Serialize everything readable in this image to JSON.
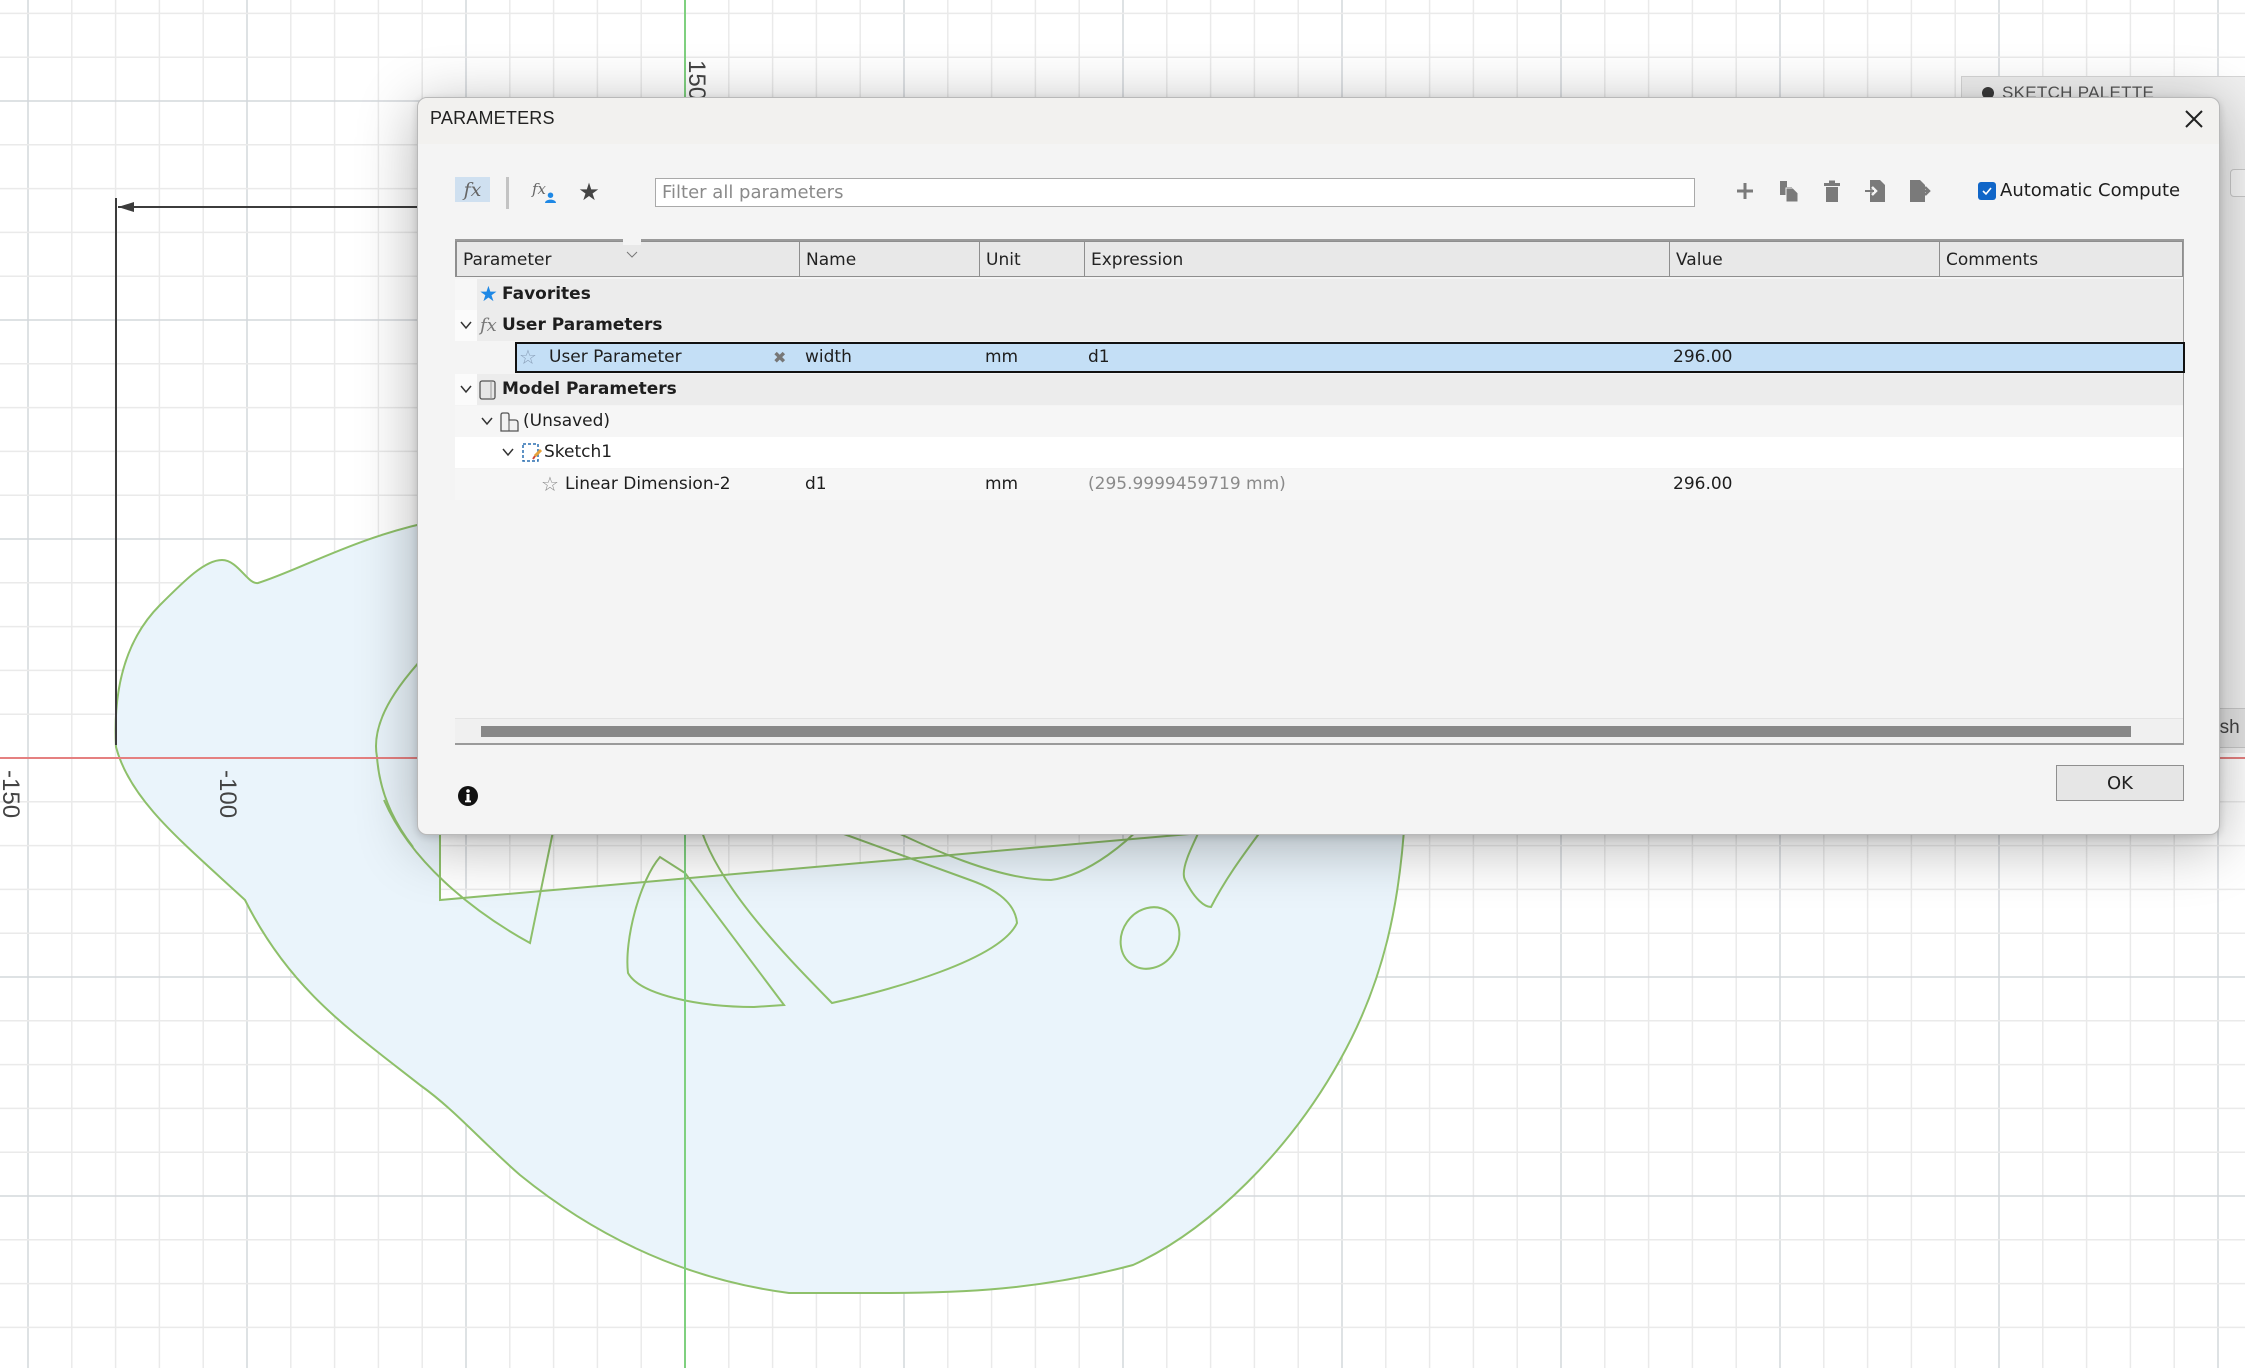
{
  "canvas": {
    "axis_labels": {
      "x_neg150": "-150",
      "x_neg100": "-100",
      "y_150": "150"
    },
    "colors": {
      "x_axis": "#e06464",
      "y_axis": "#6cc96c",
      "profile_stroke": "#8ec06a",
      "profile_fill": "#eaf4fb",
      "dimension": "#3c3c3c"
    }
  },
  "sketch_palette": {
    "title": "SKETCH PALETTE",
    "finish_label": "Finish"
  },
  "dialog": {
    "title": "PARAMETERS",
    "close_icon": "close-icon",
    "toolbar": {
      "all_params_icon": "fx",
      "user_params_icon": "fx",
      "favorites_icon": "star-icon",
      "filter": {
        "placeholder": "Filter all parameters",
        "value": ""
      },
      "actions": [
        "add-icon",
        "copy-icon",
        "delete-icon",
        "import-icon",
        "export-icon"
      ],
      "automatic_compute": {
        "label": "Automatic Compute",
        "checked": true
      }
    },
    "table": {
      "columns": [
        "Parameter",
        "Name",
        "Unit",
        "Expression",
        "Value",
        "Comments"
      ],
      "rows": {
        "favorites": {
          "label": "Favorites"
        },
        "user_params_group": {
          "label": "User Parameters",
          "icon": "fx"
        },
        "user_param": {
          "parameter": "User Parameter",
          "name": "width",
          "unit": "mm",
          "expression": "d1",
          "value": "296.00",
          "comments": "",
          "selected": true
        },
        "model_params_group": {
          "label": "Model Parameters"
        },
        "unsaved": {
          "label": "(Unsaved)"
        },
        "sketch": {
          "label": "Sketch1"
        },
        "linear_dim": {
          "parameter": "Linear Dimension-2",
          "name": "d1",
          "unit": "mm",
          "expression": "(295.9999459719 mm)",
          "value": "296.00",
          "comments": ""
        }
      }
    },
    "ok_label": "OK",
    "accent_color": "#1066c8",
    "selection_color": "#c4dff6"
  }
}
